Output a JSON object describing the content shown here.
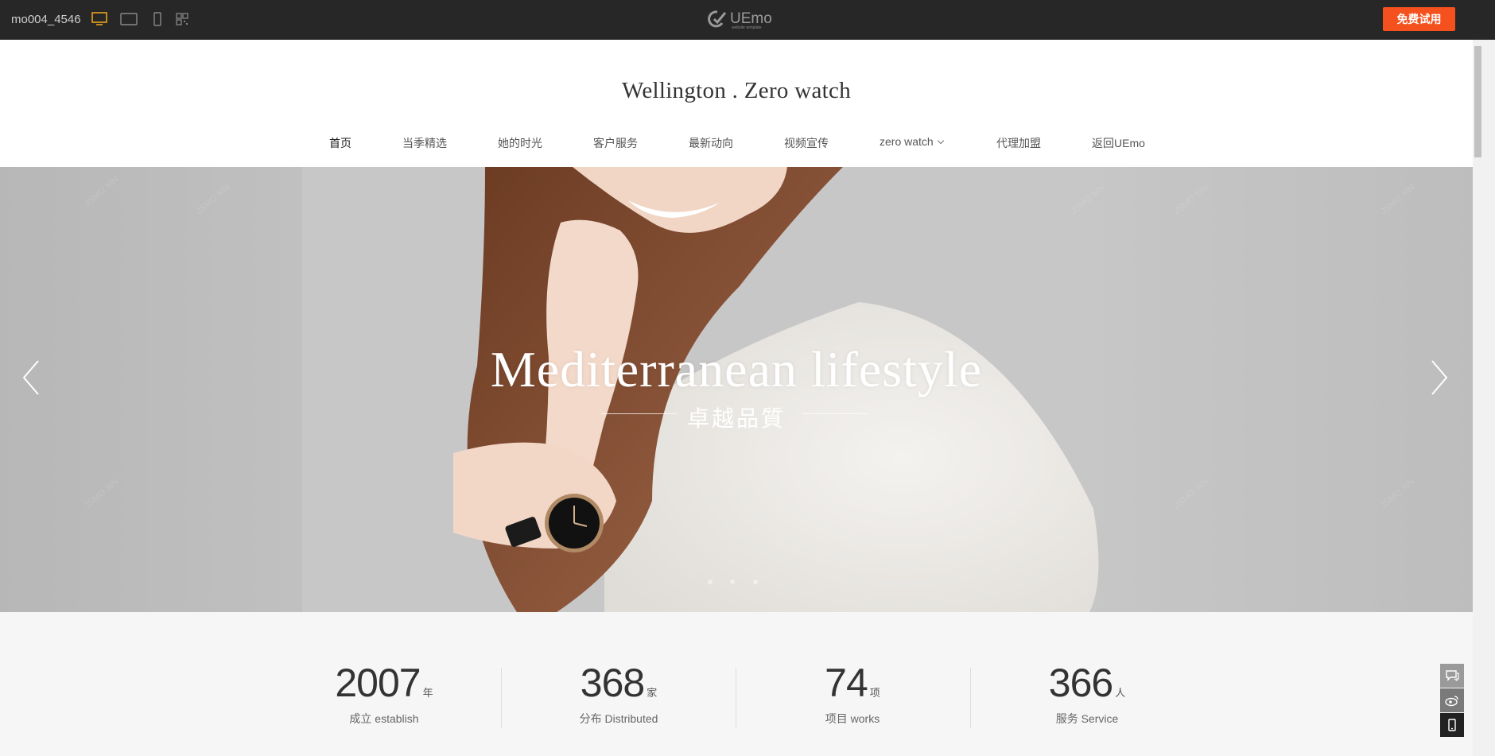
{
  "topbar": {
    "template_code": "mo004_4546",
    "devices": [
      "desktop-icon",
      "tablet-landscape-icon",
      "mobile-icon",
      "qrcode-icon"
    ],
    "logo_text": "UEmo",
    "logo_subtext": "website template",
    "trial_label": "免费试用",
    "accent": "#f4511e",
    "active_device_color": "#e9a21b"
  },
  "site": {
    "title": "Wellington . Zero watch"
  },
  "nav": {
    "items": [
      {
        "label": "首页"
      },
      {
        "label": "当季精选"
      },
      {
        "label": "她的时光"
      },
      {
        "label": "客户服务"
      },
      {
        "label": "最新动向"
      },
      {
        "label": "视频宣传"
      },
      {
        "label": "zero watch"
      },
      {
        "label": "代理加盟"
      },
      {
        "label": "返回UEmo"
      }
    ]
  },
  "hero": {
    "title": "Mediterranean lifestyle",
    "subtitle": "卓越品質",
    "watermark": "JSMO XIN",
    "slide_count": 3,
    "active_slide": 1
  },
  "stats": [
    {
      "num": "2007",
      "unit": "年",
      "label": "成立 establish"
    },
    {
      "num": "368",
      "unit": "家",
      "label": "分布 Distributed"
    },
    {
      "num": "74",
      "unit": "项",
      "label": "项目 works"
    },
    {
      "num": "366",
      "unit": "人",
      "label": "服务 Service"
    }
  ],
  "side_tools": [
    "chat-icon",
    "weibo-icon",
    "mobile-icon"
  ]
}
